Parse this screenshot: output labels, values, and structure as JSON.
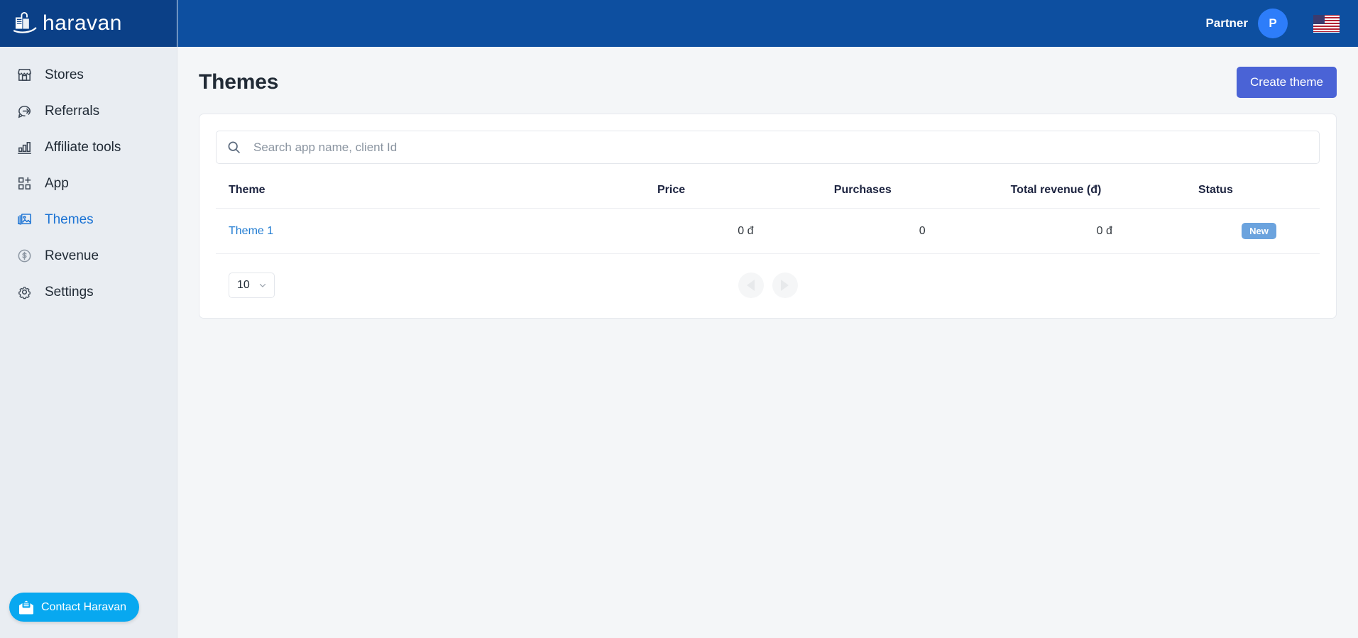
{
  "brand": {
    "name": "haravan",
    "logo_icon": "shopping-bag-icon",
    "header_bg": "#0d4fa0",
    "logo_bg": "#0b4087"
  },
  "sidebar": {
    "items": [
      {
        "label": "Stores",
        "icon": "storefront-icon",
        "active": false
      },
      {
        "label": "Referrals",
        "icon": "referral-icon",
        "active": false
      },
      {
        "label": "Affiliate tools",
        "icon": "bar-chart-icon",
        "active": false
      },
      {
        "label": "App",
        "icon": "app-grid-plus-icon",
        "active": false
      },
      {
        "label": "Themes",
        "icon": "image-stack-icon",
        "active": true
      },
      {
        "label": "Revenue",
        "icon": "dollar-circle-icon",
        "active": false
      },
      {
        "label": "Settings",
        "icon": "gear-icon",
        "active": false
      }
    ],
    "contact": {
      "label": "Contact Haravan",
      "icon": "envelope-chat-icon",
      "color": "#08a8f0"
    }
  },
  "topbar": {
    "partner_label": "Partner",
    "avatar_initial": "P",
    "avatar_color": "#2d7dfa",
    "language_flag": "us-flag-icon"
  },
  "page": {
    "title": "Themes",
    "create_button": "Create theme",
    "create_button_color": "#4a63d6"
  },
  "search": {
    "placeholder": "Search app name, client Id",
    "value": "",
    "icon": "search-icon"
  },
  "table": {
    "columns": [
      "Theme",
      "Price",
      "Purchases",
      "Total revenue (đ)",
      "Status"
    ],
    "rows": [
      {
        "theme": "Theme 1",
        "price": "0 đ",
        "purchases": "0",
        "total_revenue": "0 đ",
        "status": "New",
        "status_color": "#6ba3de"
      }
    ]
  },
  "pagination": {
    "page_size": "10",
    "prev_icon": "chevron-left-icon",
    "next_icon": "chevron-right-icon",
    "dropdown_icon": "chevron-down-icon"
  }
}
